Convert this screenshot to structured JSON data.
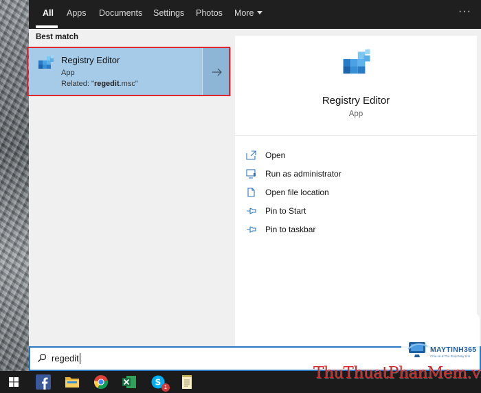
{
  "tabs": [
    {
      "label": "All"
    },
    {
      "label": "Apps"
    },
    {
      "label": "Documents"
    },
    {
      "label": "Settings"
    },
    {
      "label": "Photos"
    },
    {
      "label": "More"
    }
  ],
  "more_icon": "ellipsis-icon",
  "best_match": {
    "section_label": "Best match",
    "item": {
      "title": "Registry Editor",
      "type": "App",
      "related_prefix": "Related: \"",
      "related_term": "regedit",
      "related_suffix": ".msc\"",
      "icon": "registry-editor-icon"
    }
  },
  "detail": {
    "title": "Registry Editor",
    "type": "App",
    "actions": [
      {
        "label": "Open",
        "icon": "open-icon"
      },
      {
        "label": "Run as administrator",
        "icon": "shield-icon"
      },
      {
        "label": "Open file location",
        "icon": "file-icon"
      },
      {
        "label": "Pin to Start",
        "icon": "pin-icon"
      },
      {
        "label": "Pin to taskbar",
        "icon": "pin-icon"
      }
    ]
  },
  "search": {
    "query": "regedit"
  },
  "taskbar": {
    "items": [
      "windows-start-icon",
      "facebook-icon",
      "file-explorer-icon",
      "chrome-icon",
      "excel-icon",
      "skype-icon",
      "notepad-icon"
    ],
    "skype_badge": "1"
  },
  "watermark": {
    "logo_text": "MAYTINH365",
    "logo_tagline": "Chia sẻ & Thủ thuật Máy tính",
    "site_text": "ThuThuatPhanMem.vn"
  },
  "colors": {
    "accent": "#2b78c2",
    "selection": "#a6cbe8",
    "highlight_border": "#e0262b",
    "tabbar": "#1f1f1f"
  }
}
